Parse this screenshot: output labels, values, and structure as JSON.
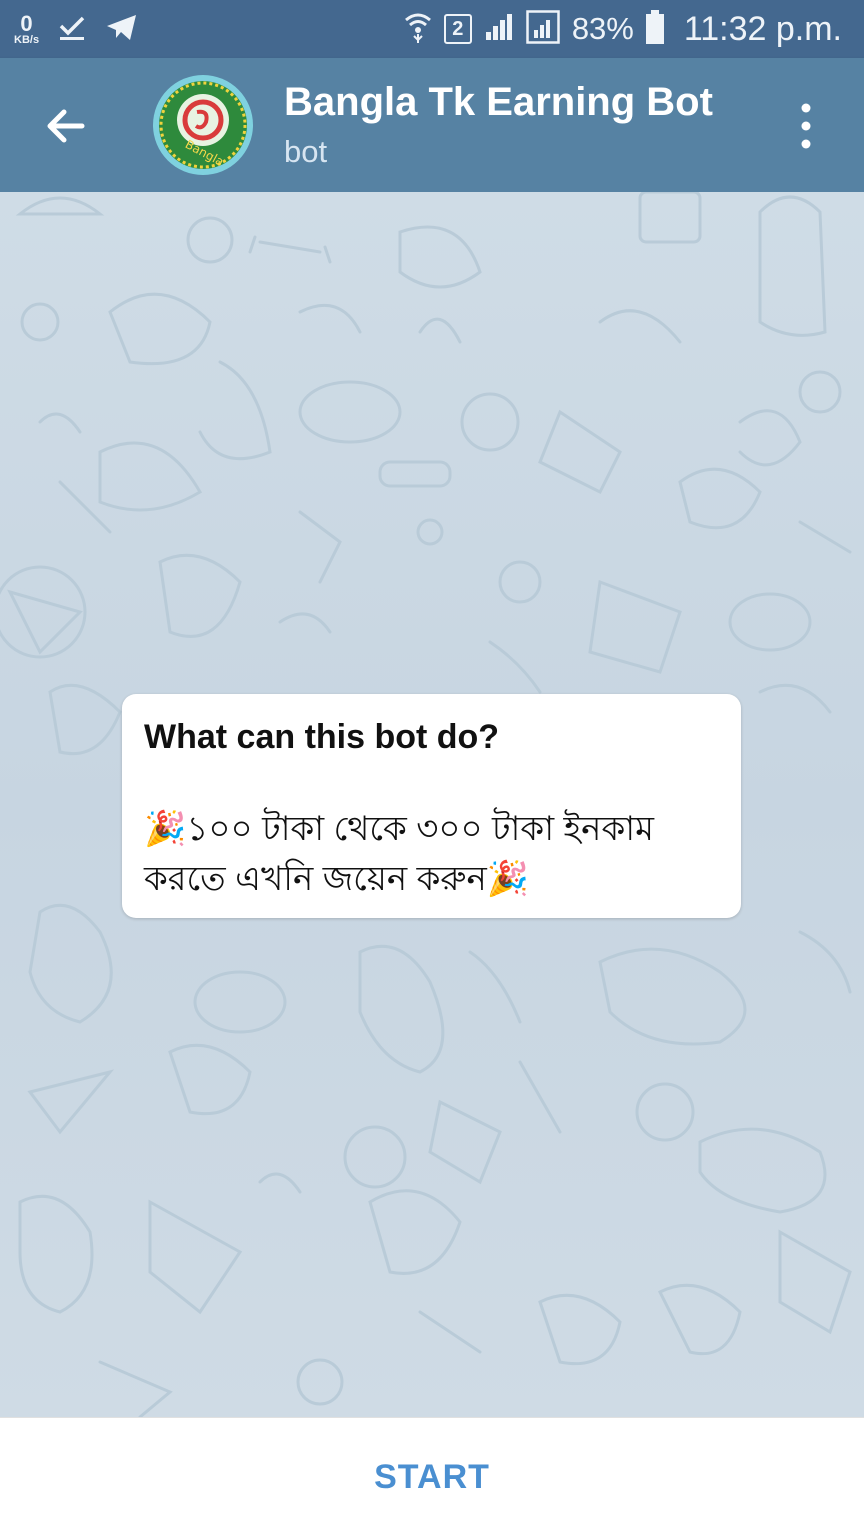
{
  "status_bar": {
    "speed_value": "0",
    "speed_unit": "KB/s",
    "sim_slot": "2",
    "battery": "83%",
    "time": "11:32 p.m."
  },
  "header": {
    "title": "Bangla Tk Earning Bot",
    "subtitle": "bot",
    "avatar_text": "Bangla"
  },
  "info_card": {
    "title": "What can this bot do?",
    "body_emoji": "🎉",
    "body_text": "১০০ টাকা থেকে ৩০০ টাকা ইনকাম করতে এখনি জয়েন করুন"
  },
  "bottom": {
    "start_label": "START"
  },
  "colors": {
    "status_bar": "#44688f",
    "app_bar": "#5682a3",
    "start_text": "#4a8fd1"
  }
}
